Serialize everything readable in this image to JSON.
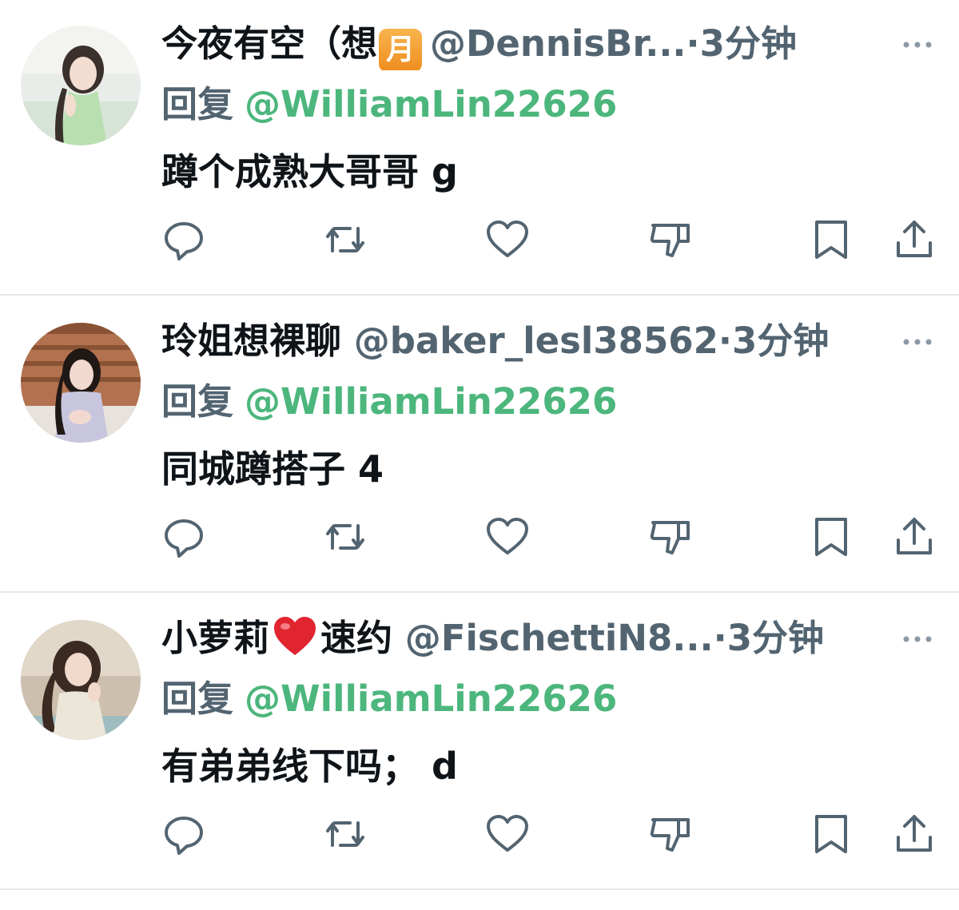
{
  "theme": {
    "text": "#0f1419",
    "secondary": "#536471",
    "mention": "#4cb67c",
    "divider": "#e6e9ec",
    "icon": "#536471"
  },
  "posts": [
    {
      "name_part1": "今夜有空（想",
      "name_emoji": "月",
      "handle": "@DennisBr...",
      "dot": "·",
      "time": "3分钟",
      "reply_prefix": "回复",
      "reply_handle": "@WilliamLin22626",
      "text": "蹲个成熟大哥哥 g",
      "avatar_icon": "avatar-photo"
    },
    {
      "name_part1": "玲姐想裸聊",
      "handle": "@baker_lesl38562",
      "dot": "·",
      "time": "3分钟",
      "reply_prefix": "回复",
      "reply_handle": "@WilliamLin22626",
      "text": "同城蹲搭子 4",
      "avatar_icon": "avatar-photo"
    },
    {
      "name_part1": "小萝莉",
      "name_emoji": "heart-emoji",
      "name_part2": "速约",
      "handle": "@FischettiN8...",
      "dot": "·",
      "time": "3分钟",
      "reply_prefix": "回复",
      "reply_handle": "@WilliamLin22626",
      "text": "有弟弟线下吗； d",
      "avatar_icon": "avatar-photo"
    }
  ],
  "actions": [
    "reply-icon",
    "repost-icon",
    "like-icon",
    "dislike-icon",
    "bookmark-icon",
    "share-icon"
  ]
}
